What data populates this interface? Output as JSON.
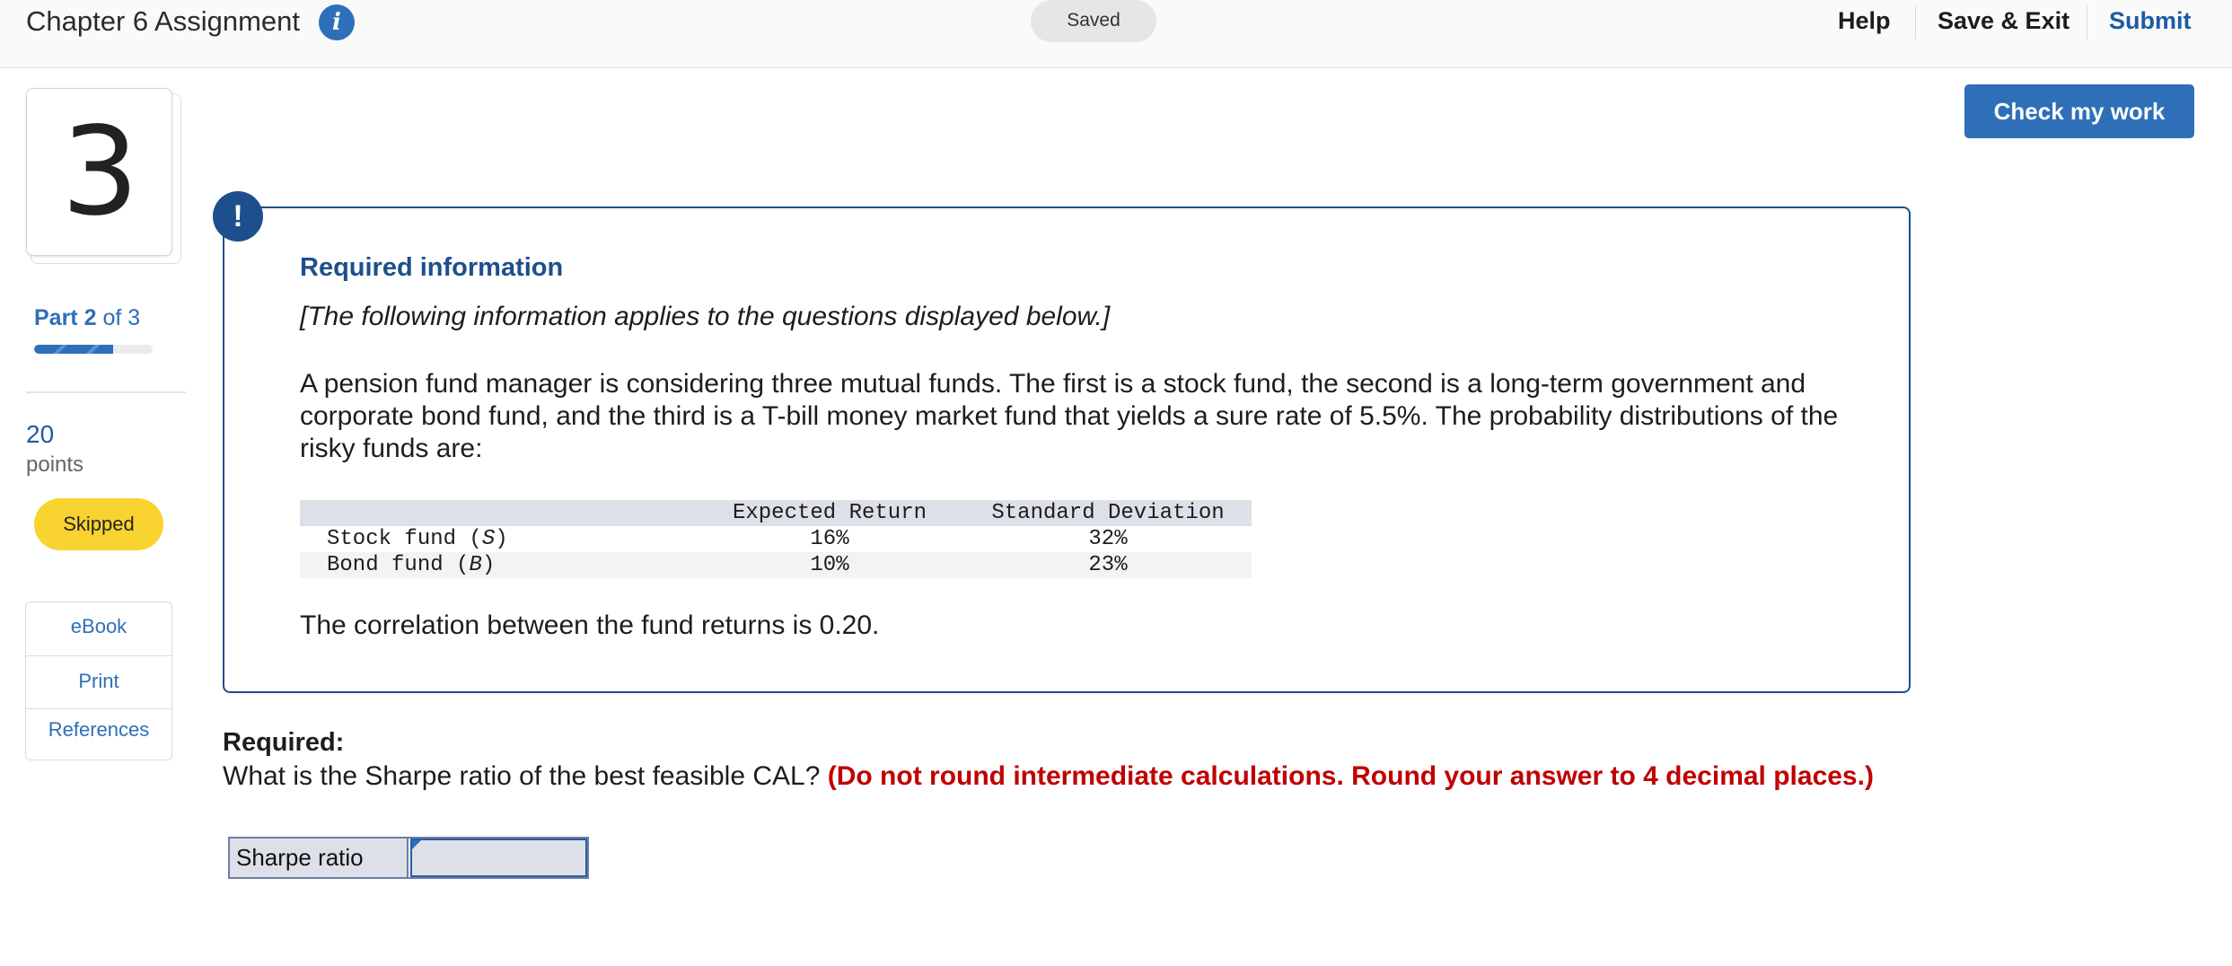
{
  "header": {
    "title": "Chapter 6 Assignment",
    "info_icon": "info-icon",
    "saved_label": "Saved",
    "help_label": "Help",
    "save_exit_label": "Save & Exit",
    "submit_label": "Submit"
  },
  "check_button_label": "Check my work",
  "sidebar": {
    "question_number": "3",
    "part_word": "Part",
    "part_current": "2",
    "part_of": "of 3",
    "progress_fraction": 0.667,
    "points_value": "20",
    "points_label": "points",
    "status_badge": "Skipped",
    "resources": [
      "eBook",
      "Print",
      "References"
    ]
  },
  "info_box": {
    "icon": "exclamation-icon",
    "title": "Required information",
    "note": "[The following information applies to the questions displayed below.]",
    "paragraph": "A pension fund manager is considering three mutual funds. The first is a stock fund, the second is a long-term government and corporate bond fund, and the third is a T-bill money market fund that yields a sure rate of 5.5%. The probability distributions of the risky funds are:",
    "table": {
      "headers": [
        "",
        "Expected Return",
        "Standard Deviation"
      ],
      "rows": [
        {
          "label": "Stock fund (",
          "symbol": "S",
          "label_end": ")",
          "expected_return": "16%",
          "std_dev": "32%"
        },
        {
          "label": "Bond fund (",
          "symbol": "B",
          "label_end": ")",
          "expected_return": "10%",
          "std_dev": "23%"
        }
      ]
    },
    "correlation": "The correlation between the fund returns is 0.20."
  },
  "required": {
    "label": "Required:",
    "question": "What is the Sharpe ratio of the best feasible CAL?",
    "instruction": "(Do not round intermediate calculations. Round your answer to 4 decimal places.)",
    "answer_label": "Sharpe ratio",
    "answer_value": ""
  },
  "colors": {
    "accent_blue": "#2e6fb8",
    "dark_blue": "#1d4f8c",
    "badge_yellow": "#f9d32f",
    "instruction_red": "#c00000"
  }
}
